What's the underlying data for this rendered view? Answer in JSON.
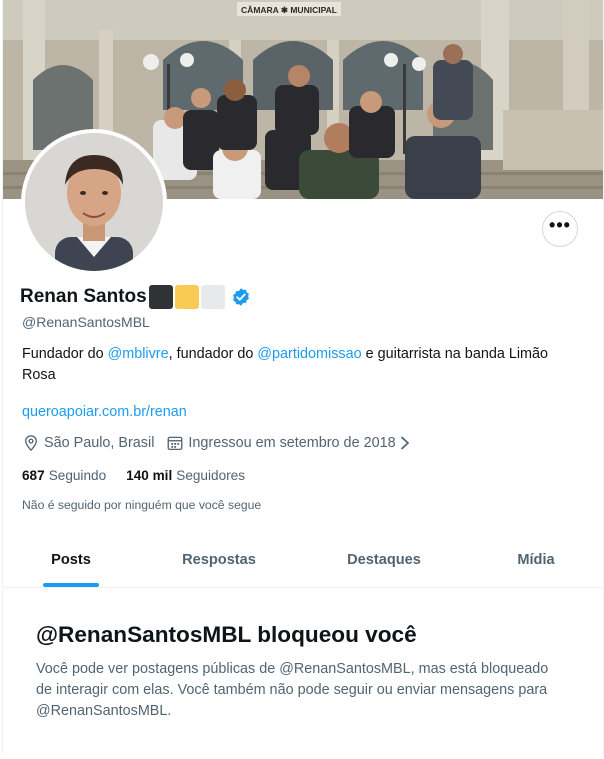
{
  "profile": {
    "name": "Renan Santos",
    "handle": "@RenanSantosMBL",
    "bio": {
      "p1": "Fundador do ",
      "m1": "@mblivre",
      "p2": ", fundador do ",
      "m2": "@partidomissao",
      "p3": " e guitarrista na banda Limão Rosa"
    },
    "website": "queroapoiar.com.br/renan",
    "location": "São Paulo, Brasil",
    "joined": "Ingressou em setembro de 2018",
    "following_count": "687",
    "following_label": "Seguindo",
    "followers_count": "140 mil",
    "followers_label": "Seguidores",
    "followed_by": "Não é seguido por ninguém que você segue",
    "name_squares": [
      "#2f3336",
      "#f9cb52",
      "#e7e9ea"
    ],
    "verified_color": "#1d9bf0"
  },
  "banner": {
    "sign": "CÂMARA ✱ MUNICIPAL"
  },
  "more_button": {
    "label": "•••"
  },
  "tabs": [
    {
      "label": "Posts",
      "active": true
    },
    {
      "label": "Respostas",
      "active": false
    },
    {
      "label": "Destaques",
      "active": false
    },
    {
      "label": "Mídia",
      "active": false
    }
  ],
  "blocked": {
    "title": "@RenanSantosMBL bloqueou você",
    "message": "Você pode ver postagens públicas de @RenanSantosMBL, mas está bloqueado de interagir com elas. Você também não pode seguir ou enviar mensagens para @RenanSantosMBL."
  }
}
